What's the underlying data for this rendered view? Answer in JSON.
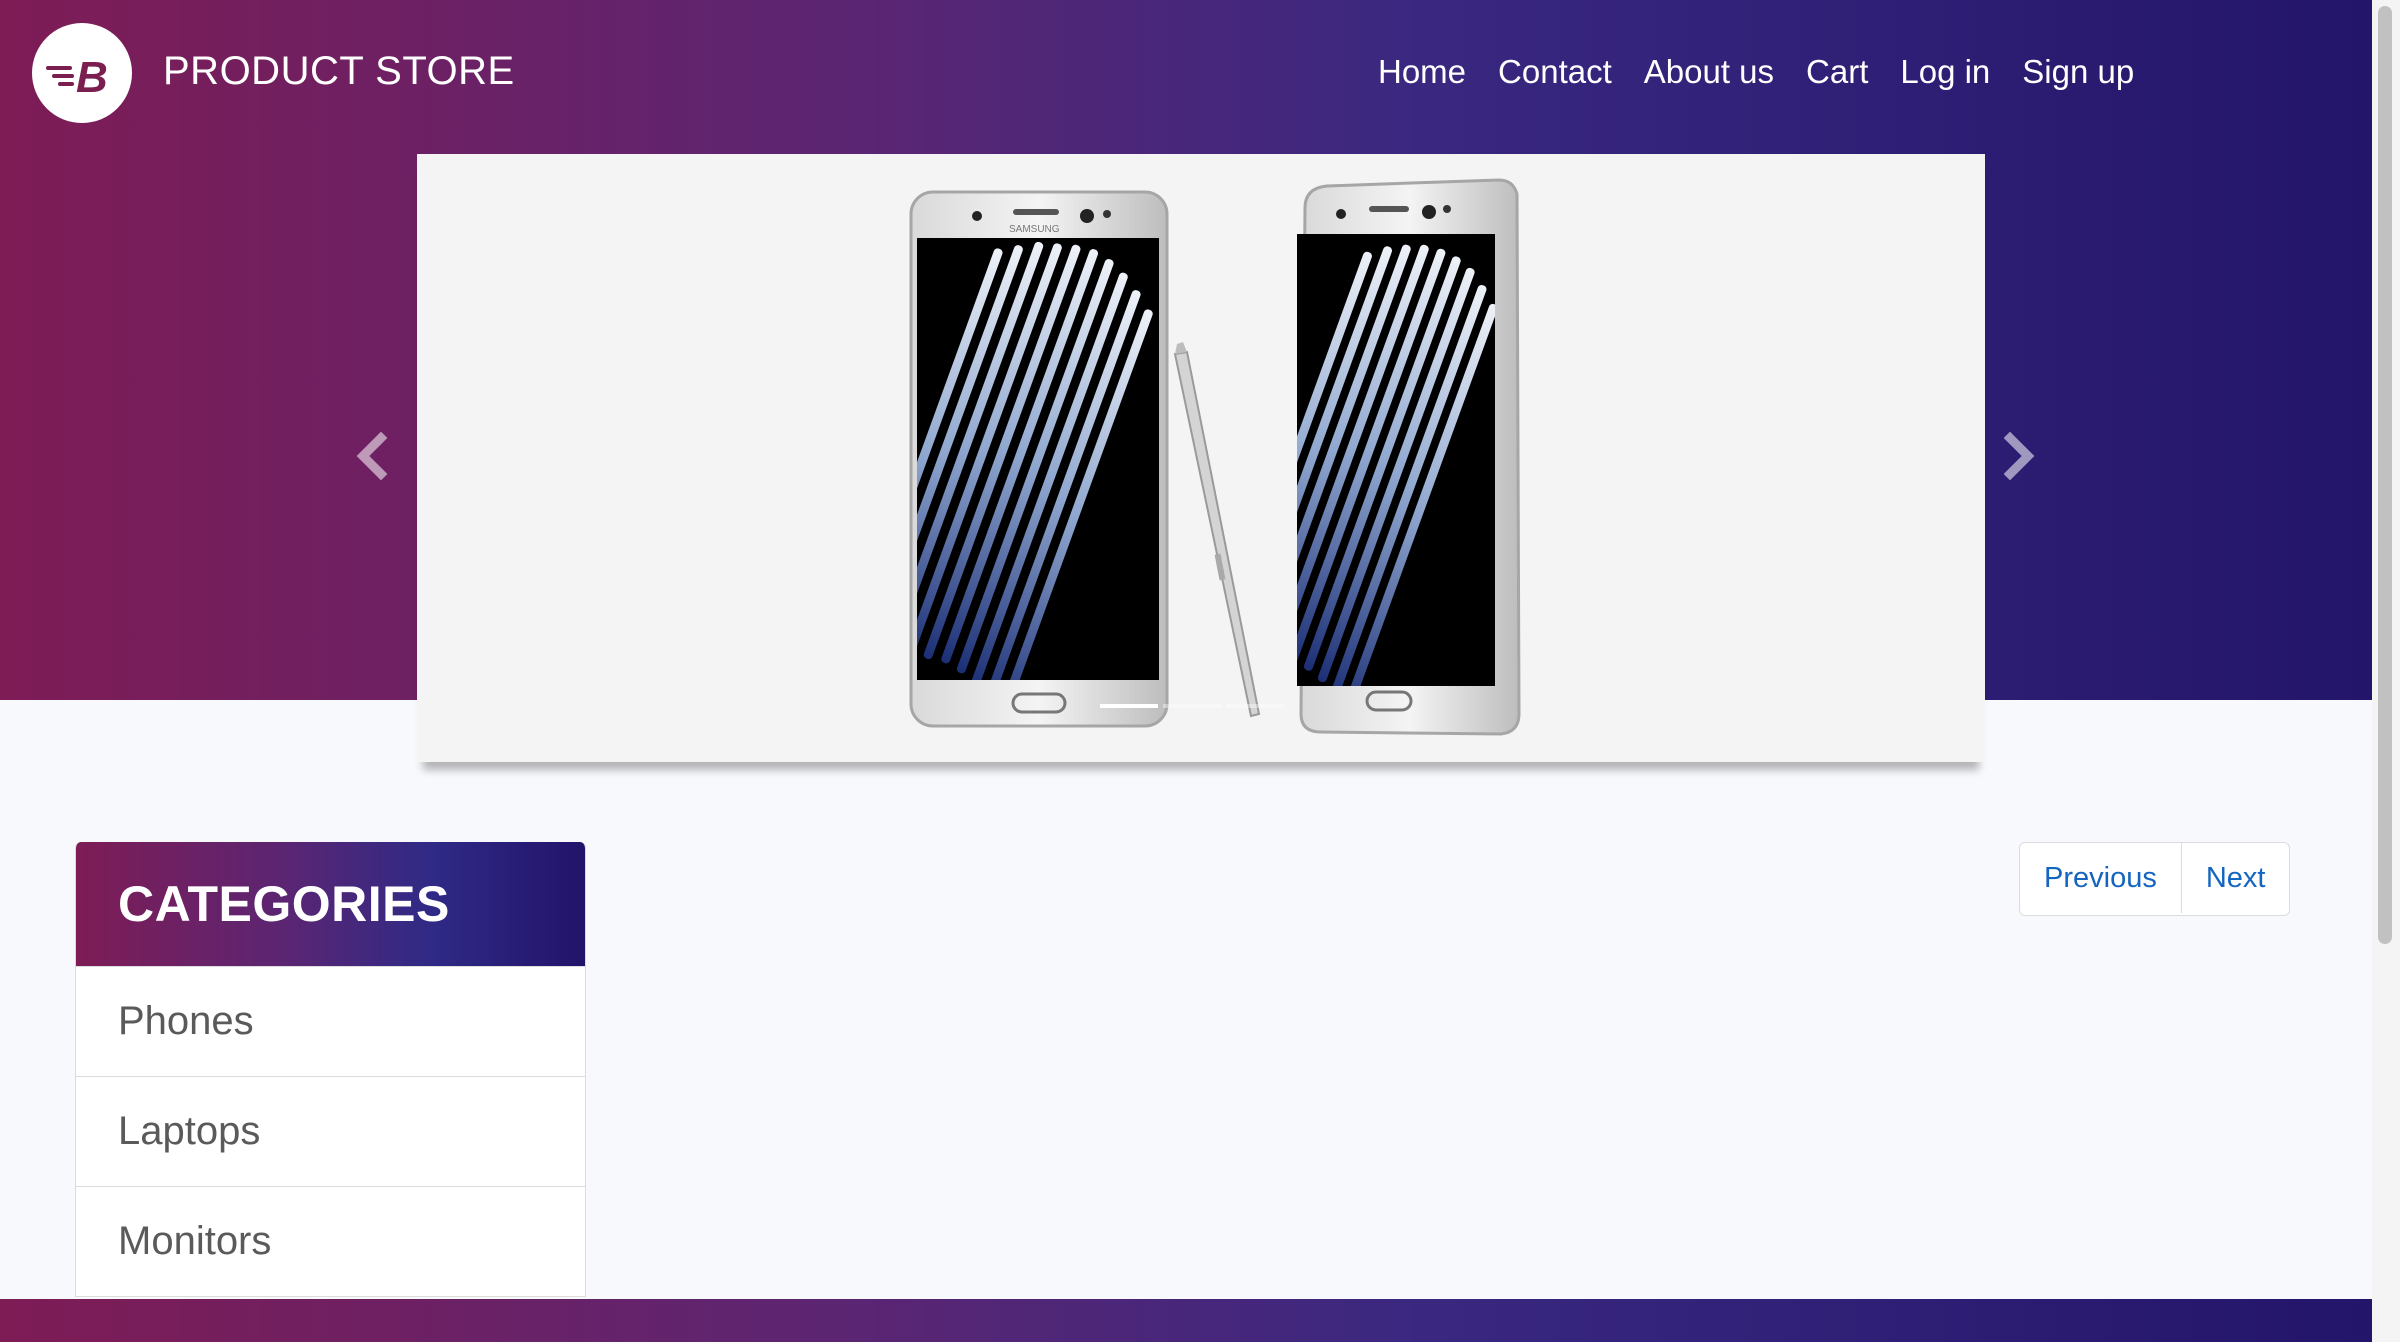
{
  "brand": {
    "name": "PRODUCT STORE",
    "logo_letter": "B"
  },
  "nav": [
    {
      "label": "Home",
      "name": "nav-home"
    },
    {
      "label": "Contact",
      "name": "nav-contact"
    },
    {
      "label": "About us",
      "name": "nav-about-us"
    },
    {
      "label": "Cart",
      "name": "nav-cart"
    },
    {
      "label": "Log in",
      "name": "nav-log-in"
    },
    {
      "label": "Sign up",
      "name": "nav-sign-up"
    }
  ],
  "carousel": {
    "slide": "samsung-galaxy-note-phones-with-stylus",
    "prev_icon": "chevron-left-icon",
    "next_icon": "chevron-right-icon",
    "phone_brand_text": "SAMSUNG",
    "indicators": 3,
    "active_indicator": 1
  },
  "pagination": {
    "previous_label": "Previous",
    "next_label": "Next"
  },
  "categories": {
    "title": "CATEGORIES",
    "items": [
      "Phones",
      "Laptops",
      "Monitors"
    ]
  },
  "colors": {
    "gradient_start": "#7e1c55",
    "gradient_end": "#23156a",
    "link_blue": "#1565c0",
    "page_bg": "#f8f9fd"
  }
}
